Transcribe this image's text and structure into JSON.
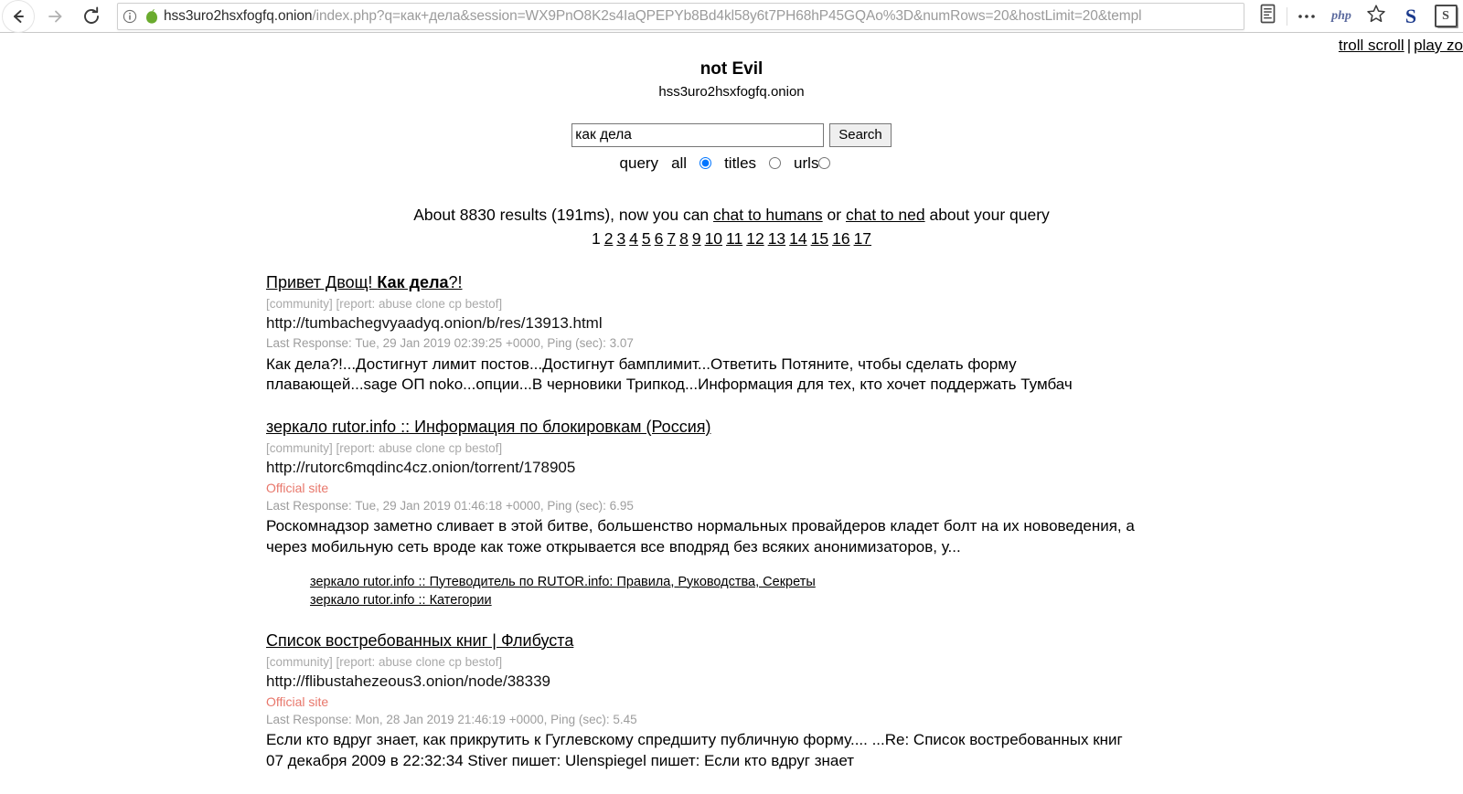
{
  "browser": {
    "back_label": "Back",
    "forward_label": "Forward",
    "reload_label": "Reload",
    "site_info_label": "Site information",
    "url_host": "hss3uro2hsxfogfq.onion",
    "url_path": "/index.php?q=как+дела&session=WX9PnO8K2s4IaQPEPYb8Bd4kl58y6t7PH68hP45GQAo%3D&numRows=20&hostLimit=20&templ",
    "icons": {
      "onion": "onion-icon",
      "reader": "reader-view-icon",
      "overflow": "overflow-menu-icon",
      "php": "php",
      "bookmark": "star-icon",
      "ext_s_bold": "S",
      "ext_s_box": "S"
    }
  },
  "corner": {
    "troll_scroll": "troll scroll",
    "separator": "|",
    "play_zork": "play zo"
  },
  "site": {
    "title": "not Evil",
    "domain": "hss3uro2hsxfogfq.onion"
  },
  "search": {
    "value": "как дела",
    "placeholder": "",
    "button_label": "Search",
    "query_label": "query",
    "options": [
      {
        "label": "all",
        "checked": true
      },
      {
        "label": "titles",
        "checked": false
      },
      {
        "label": "urls",
        "checked": false
      }
    ]
  },
  "summary": {
    "prefix": "About 8830 results (191ms), now you can ",
    "link_humans": "chat to humans",
    "middle": " or ",
    "link_ned": "chat to ned",
    "suffix": " about your query"
  },
  "pagination": {
    "current": "1",
    "pages": [
      "2",
      "3",
      "4",
      "5",
      "6",
      "7",
      "8",
      "9",
      "10",
      "11",
      "12",
      "13",
      "14",
      "15",
      "16",
      "17"
    ]
  },
  "results": [
    {
      "title_plain_1": "Привет Двощ! ",
      "title_bold": "Как дела",
      "title_plain_2": "?!",
      "tags": "[community] [report: abuse clone cp bestof]",
      "url": "http://tumbachegvyaadyq.onion/b/res/13913.html",
      "official": null,
      "meta": "Last Response: Tue, 29 Jan 2019 02:39:25 +0000, Ping (sec): 3.07",
      "snippet": "Как дела?!...Достигнут лимит постов...Достигнут бамплимит...Ответить Потяните, чтобы сделать форму плавающей...sage ОП noko...опции...В черновики Трипкод...Информация для тех, кто хочет поддержать Тумбач",
      "sublinks": []
    },
    {
      "title_plain_1": "зеркало rutor.info :: Информация по блокировкам (Россия)",
      "title_bold": "",
      "title_plain_2": "",
      "tags": "[community] [report: abuse clone cp bestof]",
      "url": "http://rutorc6mqdinc4cz.onion/torrent/178905",
      "official": "Official site",
      "meta": "Last Response: Tue, 29 Jan 2019 01:46:18 +0000, Ping (sec): 6.95",
      "snippet": "Роскомнадзор заметно сливает в этой битве, большенство нормальных провайдеров кладет болт на их нововедения, а через мобильную сеть вроде как тоже открывается все вподряд без всяких анонимизаторов, у...",
      "sublinks": [
        "зеркало rutor.info :: Путеводитель по RUTOR.info: Правила, Руководства, Секреты",
        "зеркало rutor.info :: Категории"
      ]
    },
    {
      "title_plain_1": "Список востребованных книг | Флибуста",
      "title_bold": "",
      "title_plain_2": "",
      "tags": "[community] [report: abuse clone cp bestof]",
      "url": "http://flibustahezeous3.onion/node/38339",
      "official": "Official site",
      "meta": "Last Response: Mon, 28 Jan 2019 21:46:19 +0000, Ping (sec): 5.45",
      "snippet": "Если кто вдруг знает, как прикрутить к Гуглевскому спредшиту публичную форму.... ...Re: Список востребованных книг  07 декабря 2009  в 22:32:34 Stiver пишет:   Ulenspiegel пишет:   Если кто вдруг знает",
      "sublinks": []
    }
  ],
  "colors": {
    "link": "#000000",
    "tag_gray": "#a9a9a9",
    "meta_gray": "#9d9d9d",
    "official_red": "#e8776b",
    "url_gray": "#9b9b9b",
    "onion_green": "#6aab2e"
  }
}
